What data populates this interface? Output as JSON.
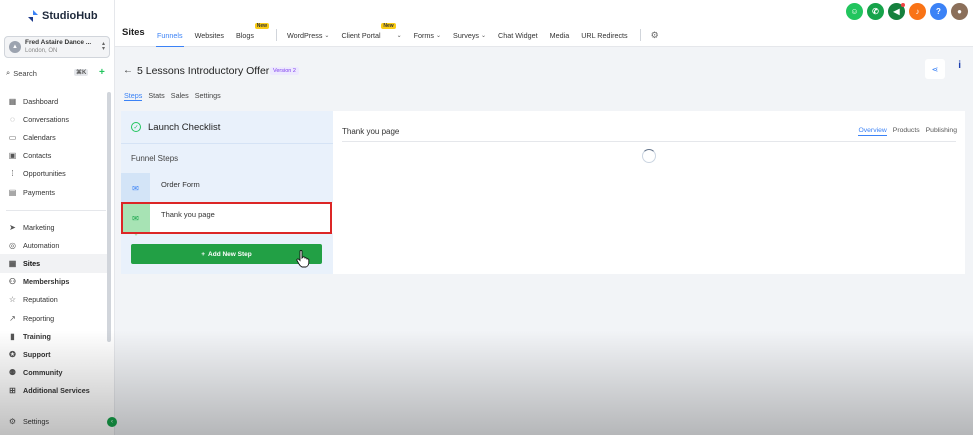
{
  "brand": {
    "name": "StudioHub"
  },
  "location": {
    "name": "Fred Astaire Dance ...",
    "city": "London, ON"
  },
  "search": {
    "label": "Search",
    "shortcut": "⌘K"
  },
  "sidebar": {
    "items": [
      {
        "label": "Dashboard",
        "icon": "grid-icon"
      },
      {
        "label": "Conversations",
        "icon": "chat-icon"
      },
      {
        "label": "Calendars",
        "icon": "calendar-icon"
      },
      {
        "label": "Contacts",
        "icon": "contacts-icon"
      },
      {
        "label": "Opportunities",
        "icon": "opportunities-icon"
      },
      {
        "label": "Payments",
        "icon": "payments-icon"
      },
      {
        "label": "Marketing",
        "icon": "send-icon"
      },
      {
        "label": "Automation",
        "icon": "automation-icon"
      },
      {
        "label": "Sites",
        "icon": "sites-icon"
      },
      {
        "label": "Memberships",
        "icon": "members-icon"
      },
      {
        "label": "Reputation",
        "icon": "star-icon"
      },
      {
        "label": "Reporting",
        "icon": "chart-icon"
      },
      {
        "label": "Training",
        "icon": "book-icon"
      },
      {
        "label": "Support",
        "icon": "support-icon"
      },
      {
        "label": "Community",
        "icon": "community-icon"
      },
      {
        "label": "Additional Services",
        "icon": "cart-icon"
      }
    ],
    "settings_label": "Settings"
  },
  "topnav": {
    "title": "Sites",
    "tabs": [
      {
        "label": "Funnels"
      },
      {
        "label": "Websites"
      },
      {
        "label": "Blogs",
        "badge": "New"
      },
      {
        "label": "WordPress"
      },
      {
        "label": "Client Portal",
        "badge": "New"
      },
      {
        "label": "Forms"
      },
      {
        "label": "Surveys"
      },
      {
        "label": "Chat Widget"
      },
      {
        "label": "Media"
      },
      {
        "label": "URL Redirects"
      }
    ],
    "icon_colors": [
      "#22c55e",
      "#16a34a",
      "#15803d",
      "#f97316",
      "#3b82f6"
    ],
    "help_label": "?"
  },
  "funnel": {
    "title": "5 Lessons Introductory Offer",
    "version": "Version 2",
    "subtabs": [
      "Steps",
      "Stats",
      "Sales",
      "Settings"
    ],
    "info_label": "i"
  },
  "checklist": {
    "label": "Launch Checklist"
  },
  "steps": {
    "heading": "Funnel Steps",
    "items": [
      {
        "label": "Order Form"
      },
      {
        "label": "Thank you page"
      }
    ],
    "add_button": "Add New Step"
  },
  "detail": {
    "page_name": "Thank you page",
    "tabs": [
      "Overview",
      "Products",
      "Publishing"
    ]
  }
}
